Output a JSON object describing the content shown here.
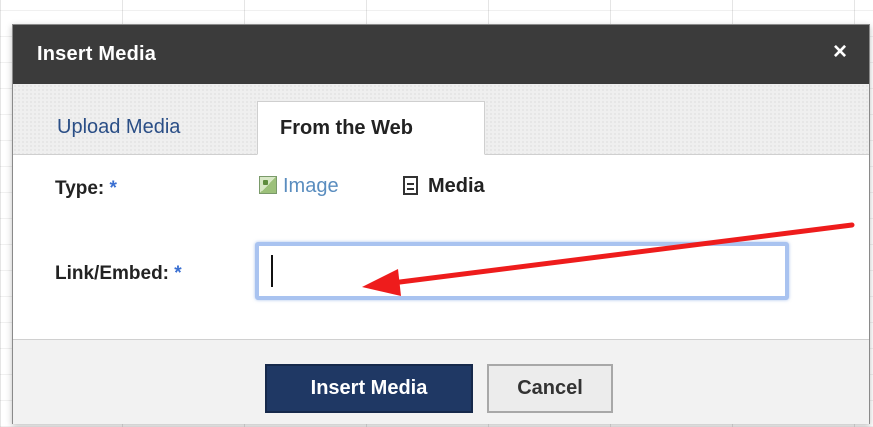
{
  "dialog": {
    "title": "Insert Media",
    "close_symbol": "×"
  },
  "tabs": [
    {
      "label": "Upload Media",
      "active": false
    },
    {
      "label": "From the Web",
      "active": true
    }
  ],
  "form": {
    "type_label": "Type:",
    "required_mark": "*",
    "type_options": [
      {
        "label": "Image",
        "icon": "image-icon",
        "selected": false
      },
      {
        "label": "Media",
        "icon": "document-icon",
        "selected": true
      }
    ],
    "link_label": "Link/Embed:",
    "link_value": ""
  },
  "buttons": {
    "insert": "Insert Media",
    "cancel": "Cancel"
  },
  "annotation": {
    "arrow_color": "#ee1c1c",
    "points_to": "link-embed-input"
  },
  "colors": {
    "titlebar": "#3b3b3b",
    "primary_button": "#1f3864",
    "link_blue": "#2a4e86",
    "required_blue": "#3a6fd1",
    "input_focus_border": "#a9c3f0"
  }
}
